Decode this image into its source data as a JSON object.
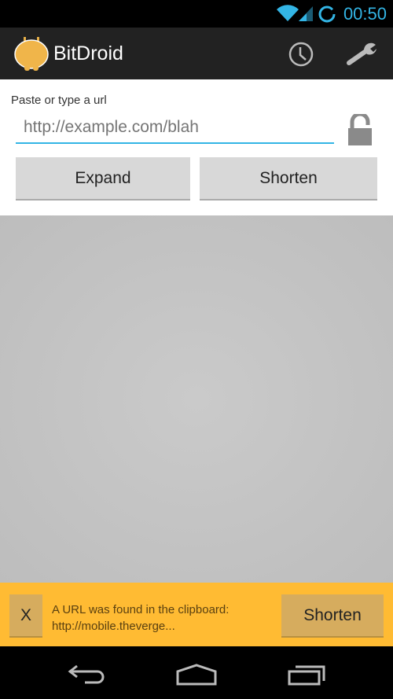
{
  "status_bar": {
    "time": "00:50",
    "icons": [
      "wifi-icon",
      "signal-icon",
      "sync-icon"
    ],
    "accent": "#33b5e5"
  },
  "action_bar": {
    "title": "BitDroid",
    "actions": [
      "history-icon",
      "settings-wrench-icon"
    ]
  },
  "form": {
    "label": "Paste or type a url",
    "url_placeholder": "http://example.com/blah",
    "url_value": "",
    "lock_icon": "unlocked-padlock-icon",
    "expand_label": "Expand",
    "shorten_label": "Shorten"
  },
  "clipboard_banner": {
    "dismiss_label": "X",
    "message_line1": "A URL was found in the clipboard:",
    "message_line2": "http://mobile.theverge...",
    "shorten_label": "Shorten",
    "color": "#ffbb33"
  },
  "nav_bar": {
    "buttons": [
      "back-icon",
      "home-icon",
      "recent-apps-icon"
    ]
  }
}
